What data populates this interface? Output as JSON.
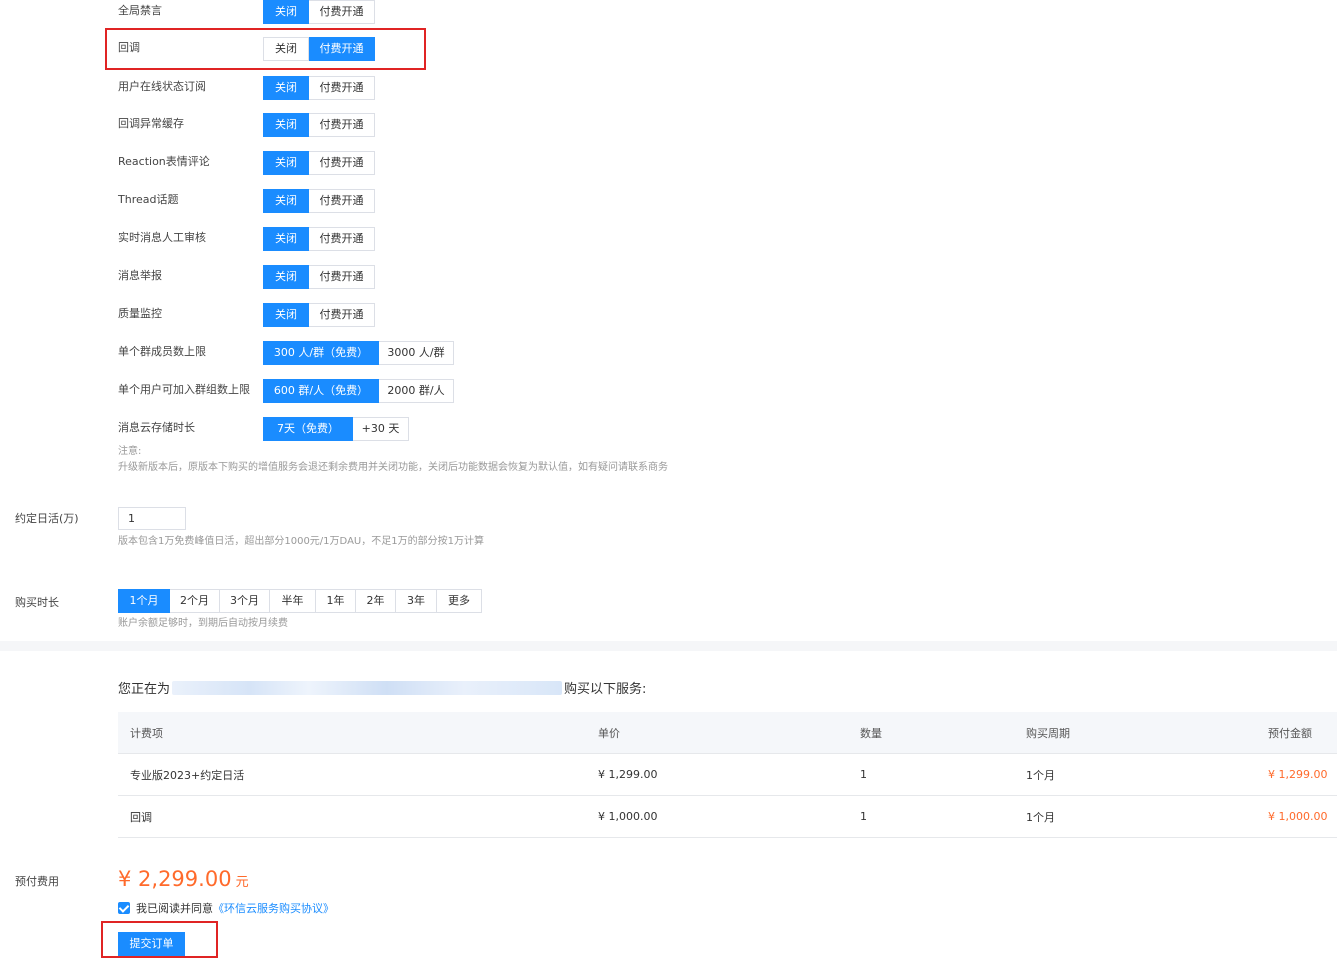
{
  "features": [
    {
      "label": "全局禁言",
      "off": "关闭",
      "on": "付费开通",
      "selected": "off"
    },
    {
      "label": "回调",
      "off": "关闭",
      "on": "付费开通",
      "selected": "on"
    },
    {
      "label": "用户在线状态订阅",
      "off": "关闭",
      "on": "付费开通",
      "selected": "off"
    },
    {
      "label": "回调异常缓存",
      "off": "关闭",
      "on": "付费开通",
      "selected": "off"
    },
    {
      "label": "Reaction表情评论",
      "off": "关闭",
      "on": "付费开通",
      "selected": "off"
    },
    {
      "label": "Thread话题",
      "off": "关闭",
      "on": "付费开通",
      "selected": "off"
    },
    {
      "label": "实时消息人工审核",
      "off": "关闭",
      "on": "付费开通",
      "selected": "off"
    },
    {
      "label": "消息举报",
      "off": "关闭",
      "on": "付费开通",
      "selected": "off"
    },
    {
      "label": "质量监控",
      "off": "关闭",
      "on": "付费开通",
      "selected": "off"
    }
  ],
  "limits": [
    {
      "label": "单个群成员数上限",
      "option_a": "300 人/群（免费）",
      "option_b": "3000 人/群"
    },
    {
      "label": "单个用户可加入群组数上限",
      "option_a": "600 群/人（免费）",
      "option_b": "2000 群/人"
    },
    {
      "label": "消息云存储时长",
      "option_a": "7天（免费）",
      "option_b": "+30 天"
    }
  ],
  "note": {
    "title": "注意:",
    "body": "升级新版本后，原版本下购买的增值服务会退还剩余费用并关闭功能，关闭后功能数据会恢复为默认值，如有疑问请联系商务"
  },
  "dau": {
    "label": "约定日活(万)",
    "value": "1",
    "hint": "版本包含1万免费峰值日活，超出部分1000元/1万DAU，不足1万的部分按1万计算"
  },
  "duration": {
    "label": "购买时长",
    "options": [
      "1个月",
      "2个月",
      "3个月",
      "半年",
      "1年",
      "2年",
      "3年",
      "更多"
    ],
    "selected": "1个月",
    "hint": "账户余额足够时，到期后自动按月续费"
  },
  "summary": {
    "prefix": "您正在为",
    "suffix": "购买以下服务:"
  },
  "table": {
    "headers": [
      "计费项",
      "单价",
      "数量",
      "购买周期",
      "预付金额"
    ],
    "rows": [
      [
        "专业版2023+约定日活",
        "¥ 1,299.00",
        "1",
        "1个月",
        "¥ 1,299.00"
      ],
      [
        "回调",
        "¥ 1,000.00",
        "1",
        "1个月",
        "¥ 1,000.00"
      ]
    ]
  },
  "prepay": {
    "label": "预付费用",
    "amount": "¥ 2,299.00",
    "unit": "元"
  },
  "agreement": {
    "text": "我已阅读并同意",
    "link": "《环信云服务购买协议》"
  },
  "submit_label": "提交订单",
  "colors": {
    "primary": "#1a8cff",
    "price": "#ff6a2b",
    "highlight_box": "#e02424"
  }
}
